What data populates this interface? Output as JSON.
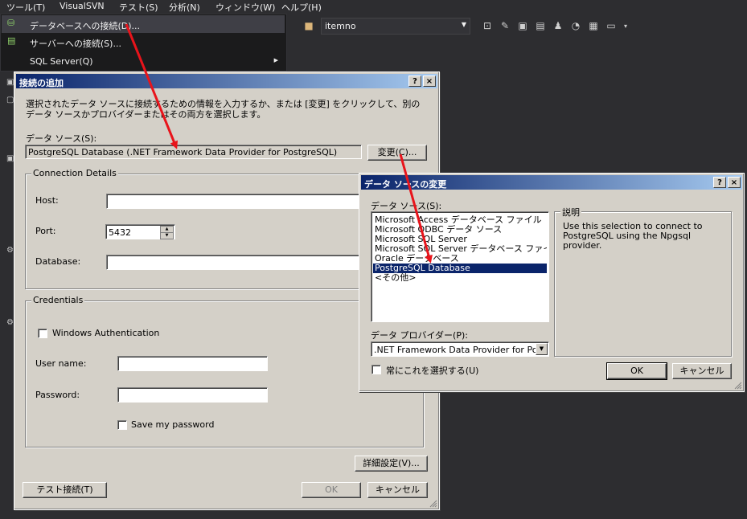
{
  "menubar": {
    "items": [
      "ツール(T)",
      "VisualSVN",
      "テスト(S)",
      "分析(N)",
      "ウィンドウ(W)",
      "ヘルプ(H)"
    ]
  },
  "context_menu": {
    "items": [
      {
        "label": "データベースへの接続(D)..."
      },
      {
        "label": "サーバーへの接続(S)..."
      },
      {
        "label": "SQL Server(Q)",
        "submenu_arrow": "▶"
      }
    ]
  },
  "toolbar": {
    "combo_value": "itemno"
  },
  "add_connection": {
    "title": "接続の追加",
    "help_btn": "?",
    "close_btn": "×",
    "description": "選択されたデータ ソースに接続するための情報を入力するか、または [変更] をクリックして、別のデータ ソースかプロバイダーまたはその両方を選択します。",
    "datasource_label": "データ ソース(S):",
    "datasource_value": "PostgreSQL Database (.NET Framework Data Provider for PostgreSQL)",
    "change_btn": "変更(C)...",
    "connection_details": {
      "caption": "Connection Details",
      "host_label": "Host:",
      "host_value": "",
      "port_label": "Port:",
      "port_value": "5432",
      "database_label": "Database:",
      "database_value": ""
    },
    "credentials": {
      "caption": "Credentials",
      "windows_auth": "Windows Authentication",
      "username_label": "User name:",
      "username_value": "",
      "password_label": "Password:",
      "password_value": "",
      "save_password": "Save my password"
    },
    "advanced_btn": "詳細設定(V)...",
    "test_btn": "テスト接続(T)",
    "ok_btn": "OK",
    "cancel_btn": "キャンセル"
  },
  "change_datasource": {
    "title": "データ ソースの変更",
    "help_btn": "?",
    "close_btn": "×",
    "datasource_label": "データ ソース(S):",
    "datasources": [
      "Microsoft Access データベース ファイル",
      "Microsoft ODBC データ ソース",
      "Microsoft SQL Server",
      "Microsoft SQL Server データベース ファイル",
      "Oracle データベース",
      "PostgreSQL Database",
      "<その他>"
    ],
    "selected_index": 5,
    "description_caption": "説明",
    "description_text": "Use this selection to connect to PostgreSQL using the Npgsql provider.",
    "provider_label": "データ プロバイダー(P):",
    "provider_value": ".NET Framework Data Provider for Pos",
    "always_select": "常にこれを選択する(U)",
    "ok_btn": "OK",
    "cancel_btn": "キャンセル"
  },
  "annotation_color": "#e8141b"
}
